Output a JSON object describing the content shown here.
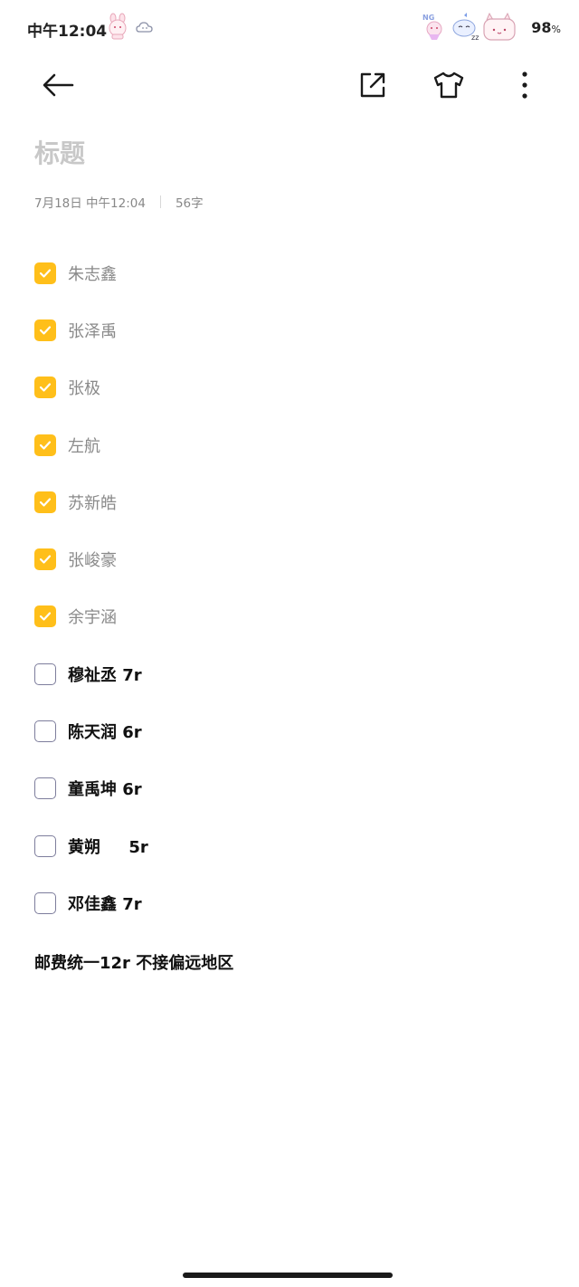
{
  "status_bar": {
    "time": "中午12:04",
    "battery": "98",
    "battery_unit": "%"
  },
  "toolbar": {
    "back_icon": "back-arrow-icon",
    "share_icon": "share-icon",
    "theme_icon": "tshirt-icon",
    "more_icon": "more-vertical-icon"
  },
  "note": {
    "title_placeholder": "标题",
    "date": "7月18日 中午12:04",
    "word_count": "56字",
    "items": [
      {
        "text": "朱志鑫",
        "checked": true
      },
      {
        "text": "张泽禹",
        "checked": true
      },
      {
        "text": "张极",
        "checked": true
      },
      {
        "text": "左航",
        "checked": true
      },
      {
        "text": "苏新皓",
        "checked": true
      },
      {
        "text": "张峻豪",
        "checked": true
      },
      {
        "text": "余宇涵",
        "checked": true
      },
      {
        "text": "穆祉丞 7r",
        "checked": false
      },
      {
        "text": "陈天润 6r",
        "checked": false
      },
      {
        "text": "童禹坤 6r",
        "checked": false
      },
      {
        "text": "黄朔     5r",
        "checked": false
      },
      {
        "text": "邓佳鑫 7r",
        "checked": false
      }
    ],
    "footer": "邮费统一12r 不接偏远地区"
  },
  "colors": {
    "checkbox_checked": "#ffbf1a",
    "checkbox_border": "#7d7d9c",
    "title_placeholder": "#c8c8c8"
  }
}
